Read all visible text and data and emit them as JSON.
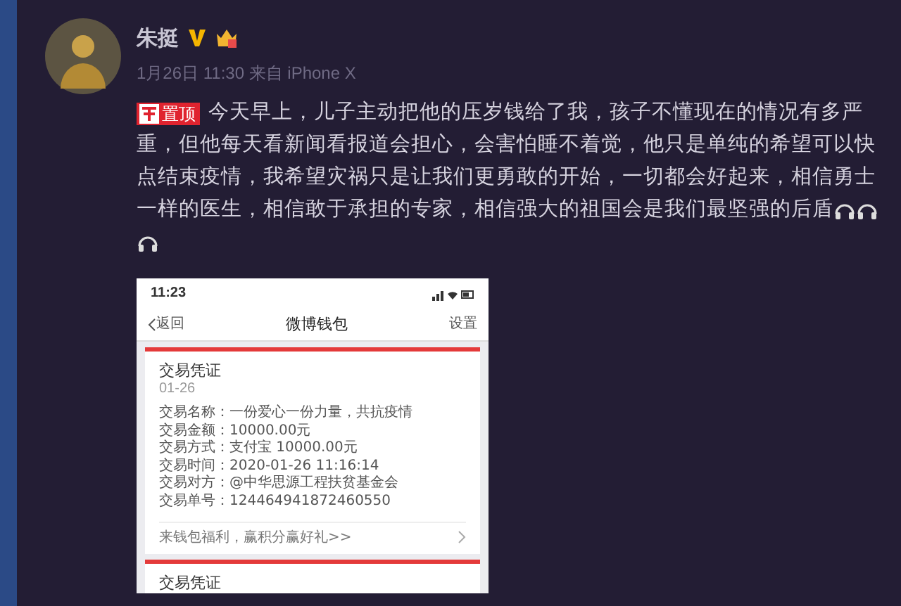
{
  "author": {
    "name": "朱挺",
    "meta": "1月26日 11:30 来自 iPhone X"
  },
  "post": {
    "pinned_label": "置顶",
    "lines": [
      "今天早上，儿子主动把他的压岁钱给了我，孩子不懂现在的情况有多严",
      "重，但他每天看新闻看报道会担心，会害怕睡不着觉，他只是单纯的希望可以快",
      "点结束疫情，我希望灾祸只是让我们更勇敢的开始，一切都会好起来，相信勇士",
      "一样的医生，相信敢于承担的专家，相信强大的祖国会是我们最坚强的后盾"
    ]
  },
  "phone": {
    "status_time": "11:23",
    "nav": {
      "back": "返回",
      "title": "微博钱包",
      "action": "设置"
    },
    "cards": [
      {
        "title": "交易凭证",
        "date": "01-26",
        "rows": [
          "交易名称：一份爱心一份力量，共抗疫情",
          "交易金额：10000.00元",
          "交易方式：支付宝 10000.00元",
          "交易时间：2020-01-26 11:16:14",
          "交易对方：@中华思源工程扶贫基金会",
          "交易单号：124464941872460550"
        ],
        "footer": "来钱包福利，赢积分赢好礼>>"
      },
      {
        "title": "交易凭证"
      }
    ]
  }
}
